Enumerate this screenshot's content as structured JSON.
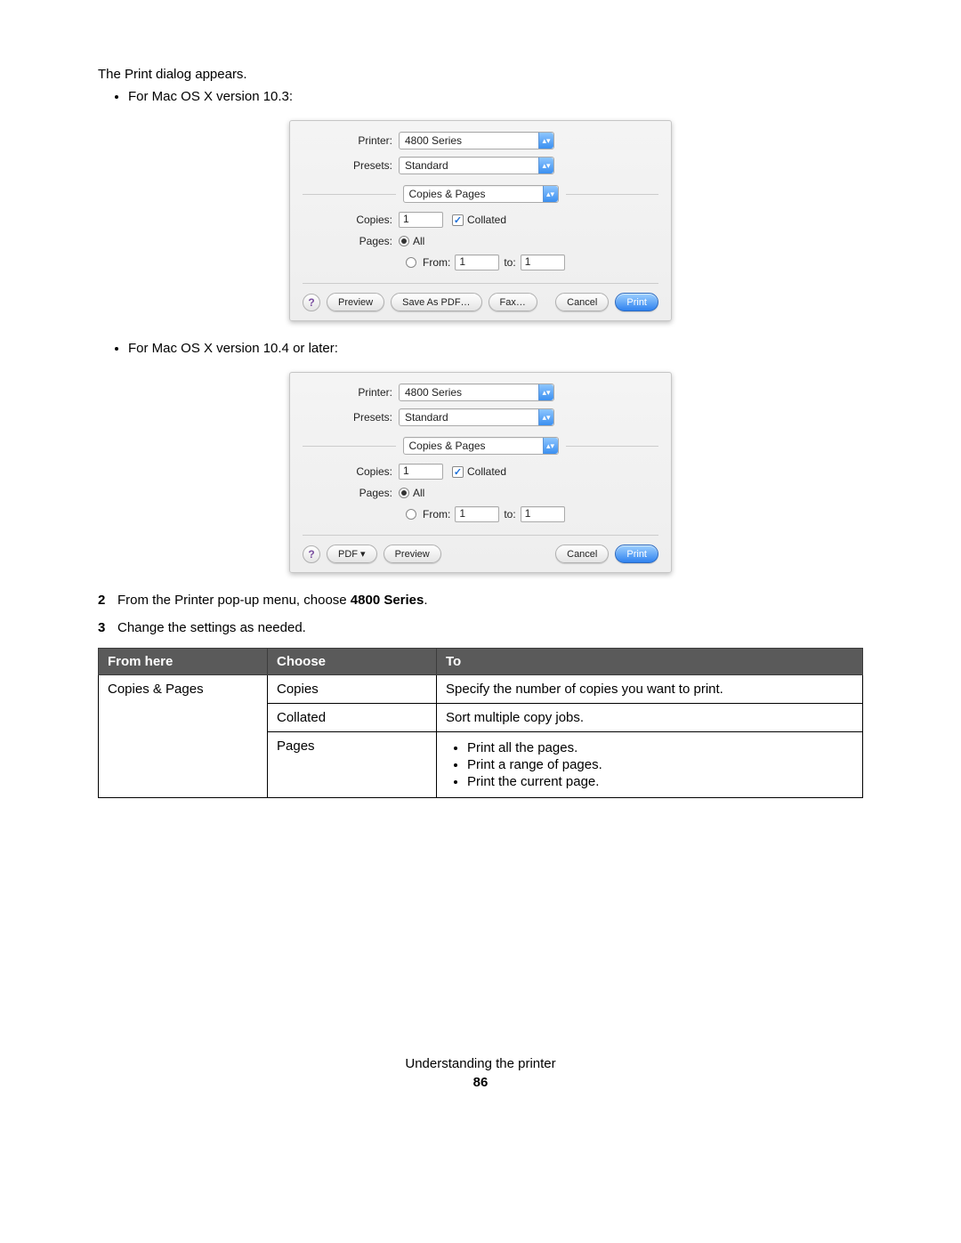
{
  "text": {
    "intro": "The Print dialog appears.",
    "bullet103": "For Mac OS X version 10.3:",
    "bullet104": "For Mac OS X version 10.4 or later:",
    "step2_prefix": "From the Printer pop-up menu, choose ",
    "step2_bold": "4800 Series",
    "step2_suffix": ".",
    "step3": "Change the settings as needed.",
    "footer_section": "Understanding the printer",
    "footer_page": "86"
  },
  "dialog": {
    "labels": {
      "printer": "Printer:",
      "presets": "Presets:",
      "copies": "Copies:",
      "pages": "Pages:",
      "from": "From:",
      "to": "to:",
      "all": "All",
      "collated": "Collated",
      "section": "Copies & Pages"
    },
    "values": {
      "printer": "4800 Series",
      "presets": "Standard",
      "copies": "1",
      "from": "1",
      "to": "1"
    },
    "buttons103": {
      "help": "?",
      "preview": "Preview",
      "savepdf": "Save As PDF…",
      "fax": "Fax…",
      "cancel": "Cancel",
      "print": "Print"
    },
    "buttons104": {
      "help": "?",
      "pdf": "PDF ▾",
      "preview": "Preview",
      "cancel": "Cancel",
      "print": "Print"
    }
  },
  "table": {
    "headers": {
      "c1": "From here",
      "c2": "Choose",
      "c3": "To"
    },
    "rows": {
      "r1": {
        "c1": "Copies & Pages",
        "c2": "Copies",
        "c3": "Specify the number of copies you want to print."
      },
      "r2": {
        "c2": "Collated",
        "c3": "Sort multiple copy jobs."
      },
      "r3": {
        "c2": "Pages",
        "b1": "Print all the pages.",
        "b2": "Print a range of pages.",
        "b3": "Print the current page."
      }
    }
  }
}
